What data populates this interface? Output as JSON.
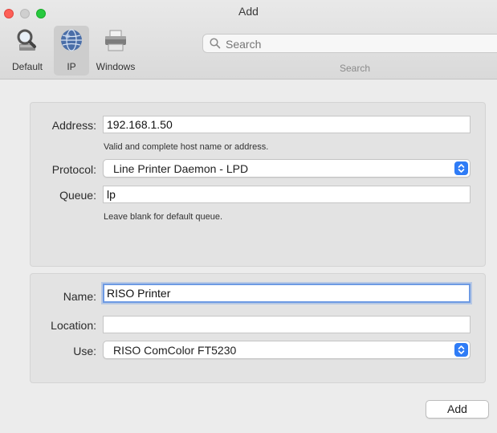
{
  "window": {
    "title": "Add"
  },
  "toolbar": {
    "items": [
      {
        "label": "Default",
        "icon": "default-printer-icon"
      },
      {
        "label": "IP",
        "icon": "globe-network-icon",
        "selected": true
      },
      {
        "label": "Windows",
        "icon": "windows-printer-icon"
      }
    ],
    "search": {
      "placeholder": "Search",
      "caption": "Search"
    }
  },
  "connection": {
    "address": {
      "label": "Address:",
      "value": "192.168.1.50",
      "hint": "Valid and complete host name or address."
    },
    "protocol": {
      "label": "Protocol:",
      "value": "Line Printer Daemon - LPD"
    },
    "queue": {
      "label": "Queue:",
      "value": "lp",
      "hint": "Leave blank for default queue."
    }
  },
  "printer": {
    "name": {
      "label": "Name:",
      "value": "RISO Printer"
    },
    "location": {
      "label": "Location:",
      "value": ""
    },
    "use": {
      "label": "Use:",
      "value": "RISO ComColor FT5230"
    }
  },
  "footer": {
    "add_label": "Add"
  },
  "colors": {
    "accent": "#2f7cf6",
    "focus_ring": "#6d9ae3",
    "close": "#fd5f57",
    "maximize": "#27c93f"
  }
}
